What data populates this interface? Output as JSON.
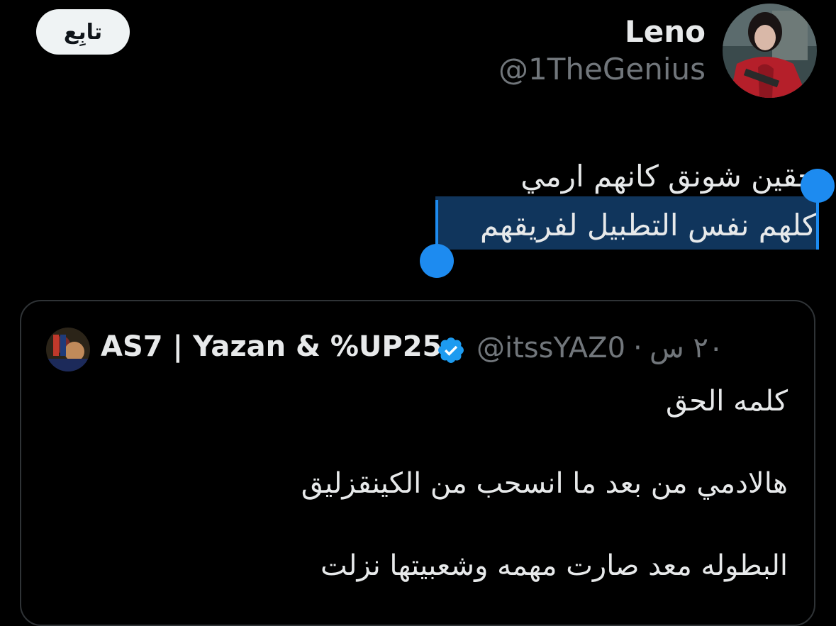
{
  "tweet": {
    "follow_label": "تابِع",
    "author_name": "Leno",
    "author_handle": "@1TheGenius",
    "text_lines": [
      "حقين شونق كانهم ارمي",
      "كلهم نفس التطبيل لفريقهم"
    ],
    "selected_line_index": 1
  },
  "quoted_tweet": {
    "author_name": "AS7 | Yazan & %UP25",
    "author_handle": "@itssYAZ0",
    "separator": "·",
    "time": "٢٠ س",
    "verified": true,
    "text_lines": [
      "كلمه الحق",
      "هالادمي من بعد ما انسحب من الكينقزليق",
      "البطوله معد صارت مهمه وشعبيتها نزلت"
    ]
  },
  "icons": {
    "avatar": "profile-photo",
    "quoted_avatar": "profile-photo",
    "verified": "verified-badge-icon"
  },
  "colors": {
    "background": "#000000",
    "text_primary": "#e7e9ea",
    "text_secondary": "#71767b",
    "selection": "#10355c",
    "selection_handle": "#1d8bf0",
    "verified": "#1d9bf0",
    "follow_button_bg": "#eff3f4"
  }
}
